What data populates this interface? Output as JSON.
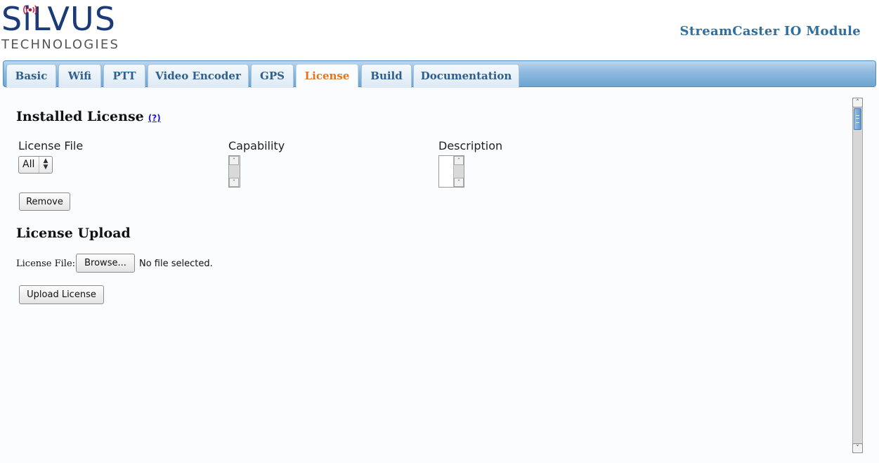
{
  "header": {
    "logo_word": "SiLVUS",
    "logo_sub": "TECHNOLOGIES",
    "module_title": "StreamCaster IO Module"
  },
  "tabs": [
    {
      "label": "Basic",
      "active": false
    },
    {
      "label": "Wifi",
      "active": false
    },
    {
      "label": "PTT",
      "active": false
    },
    {
      "label": "Video Encoder",
      "active": false
    },
    {
      "label": "GPS",
      "active": false
    },
    {
      "label": "License",
      "active": true
    },
    {
      "label": "Build",
      "active": false
    },
    {
      "label": "Documentation",
      "active": false
    }
  ],
  "installed": {
    "title": "Installed License",
    "help": "(?)",
    "license_file_label": "License File",
    "capability_label": "Capability",
    "description_label": "Description",
    "select_value": "All",
    "remove_label": "Remove"
  },
  "upload": {
    "title": "License Upload",
    "file_label": "License File:",
    "browse_label": "Browse...",
    "no_file_text": "No file selected.",
    "upload_label": "Upload License"
  },
  "colors": {
    "brand": "#1b3a78",
    "tab_text": "#2e5f8e",
    "active_tab_text": "#e0761e",
    "tabbar": "#6ea5d3"
  },
  "icons": {
    "logo_signal": "radio-signal-icon",
    "select_arrows": "up-down-arrows-icon",
    "scroll_up": "chevron-up-icon",
    "scroll_down": "chevron-down-icon"
  }
}
